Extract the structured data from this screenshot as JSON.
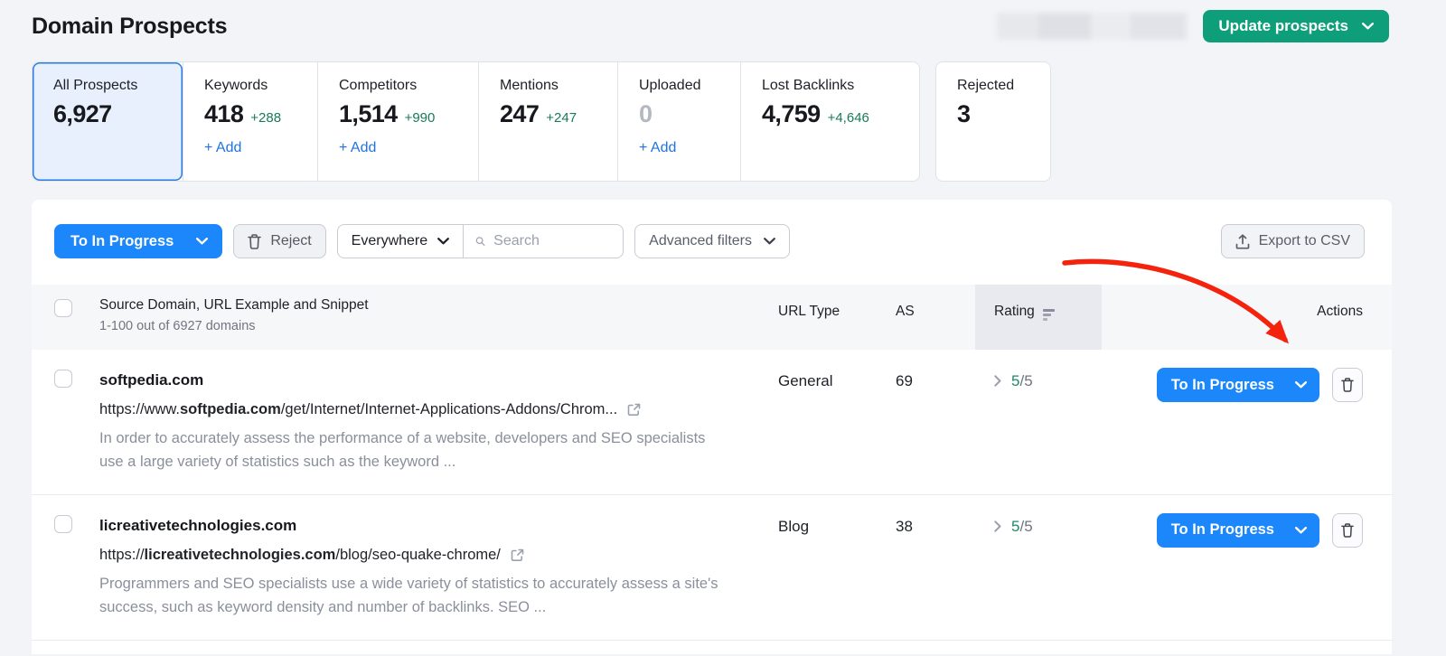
{
  "page": {
    "title": "Domain Prospects"
  },
  "header": {
    "update_button_label": "Update prospects"
  },
  "labels": {
    "add": "+ Add"
  },
  "tabs": [
    {
      "label": "All Prospects",
      "count": "6,927",
      "delta": "",
      "selected": true
    },
    {
      "label": "Keywords",
      "count": "418",
      "delta": "+288"
    },
    {
      "label": "Competitors",
      "count": "1,514",
      "delta": "+990"
    },
    {
      "label": "Mentions",
      "count": "247",
      "delta": "+247"
    },
    {
      "label": "Uploaded",
      "count": "0",
      "delta": ""
    },
    {
      "label": "Lost Backlinks",
      "count": "4,759",
      "delta": "+4,646"
    },
    {
      "label": "Rejected",
      "count": "3",
      "delta": ""
    }
  ],
  "toolbar": {
    "bulk_action_label": "To In Progress",
    "reject_label": "Reject",
    "scope_value": "Everywhere",
    "search_placeholder": "Search",
    "advanced_filters_label": "Advanced filters",
    "export_label": "Export to CSV"
  },
  "table": {
    "header": {
      "main_title": "Source Domain, URL Example and Snippet",
      "main_subtitle": "1-100 out of 6927 domains",
      "url_type": "URL Type",
      "as": "AS",
      "rating": "Rating",
      "actions": "Actions"
    },
    "rows": [
      {
        "domain": "softpedia.com",
        "url_prefix": "https://www.",
        "url_domain": "softpedia.com",
        "url_path": "/get/Internet/Internet-Applications-Addons/Chrom...",
        "snippet": "In order to accurately assess the performance of a website, developers and SEO specialists use a large variety of statistics such as the keyword ...",
        "url_type": "General",
        "as": "69",
        "rating_value": "5",
        "rating_total": "/5",
        "action_label": "To In Progress"
      },
      {
        "domain": "licreativetechnologies.com",
        "url_prefix": "https://",
        "url_domain": "licreativetechnologies.com",
        "url_path": "/blog/seo-quake-chrome/",
        "snippet": "Programmers and SEO specialists use a wide variety of statistics to accurately assess a site's success, such as keyword density and number of backlinks. SEO ...",
        "url_type": "Blog",
        "as": "38",
        "rating_value": "5",
        "rating_total": "/5",
        "action_label": "To In Progress"
      }
    ]
  },
  "colors": {
    "accent_blue": "#1b87fb",
    "brand_green": "#0e9e7a",
    "positive_green": "#177a5b",
    "link_blue": "#1f74e0",
    "annotation_red": "#f4230e",
    "selected_tab_bg": "#e7f0fc",
    "selected_tab_border": "#2b7ce0"
  }
}
